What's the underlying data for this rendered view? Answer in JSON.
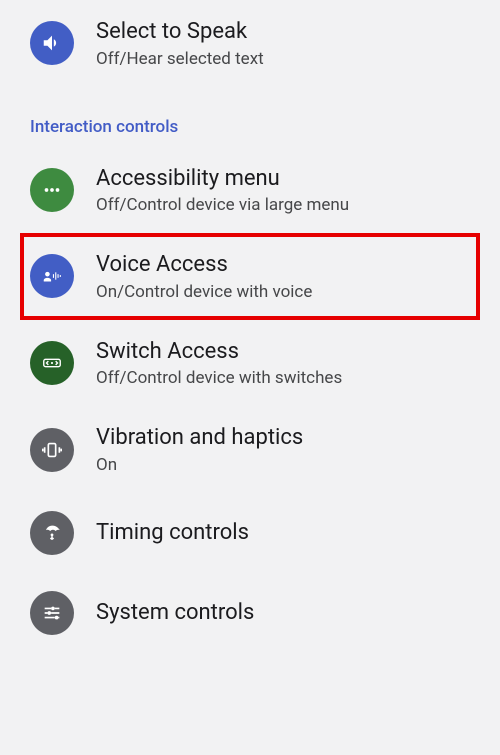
{
  "items": {
    "select_to_speak": {
      "title": "Select to Speak",
      "subtitle": "Off/Hear selected text"
    },
    "accessibility_menu": {
      "title": "Accessibility menu",
      "subtitle": "Off/Control device via large menu"
    },
    "voice_access": {
      "title": "Voice Access",
      "subtitle": "On/Control device with voice"
    },
    "switch_access": {
      "title": "Switch Access",
      "subtitle": "Off/Control device with switches"
    },
    "vibration": {
      "title": "Vibration and haptics",
      "subtitle": "On"
    },
    "timing": {
      "title": "Timing controls"
    },
    "system": {
      "title": "System controls"
    }
  },
  "section": {
    "interaction": "Interaction controls"
  }
}
